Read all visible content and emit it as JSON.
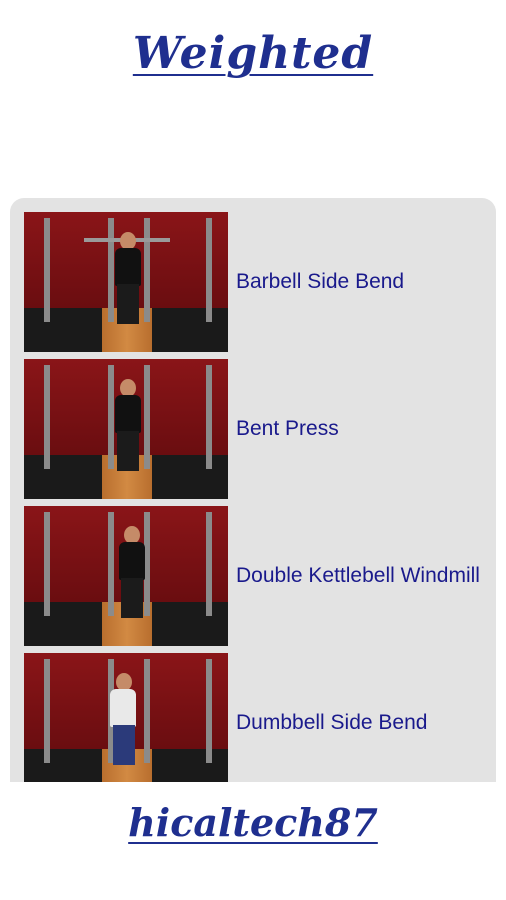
{
  "header": {
    "title": "Weighted"
  },
  "exercises": [
    {
      "label": "Barbell Side Bend",
      "thumbnail": "exercise-thumbnail"
    },
    {
      "label": "Bent Press",
      "thumbnail": "exercise-thumbnail"
    },
    {
      "label": "Double Kettlebell Windmill",
      "thumbnail": "exercise-thumbnail"
    },
    {
      "label": "Dumbbell Side Bend",
      "thumbnail": "exercise-thumbnail"
    }
  ],
  "footer": {
    "signature": "hicaltech87"
  },
  "colors": {
    "text": "#1a1a8c",
    "panel": "#e3e3e3",
    "wall": "#7a1114"
  }
}
